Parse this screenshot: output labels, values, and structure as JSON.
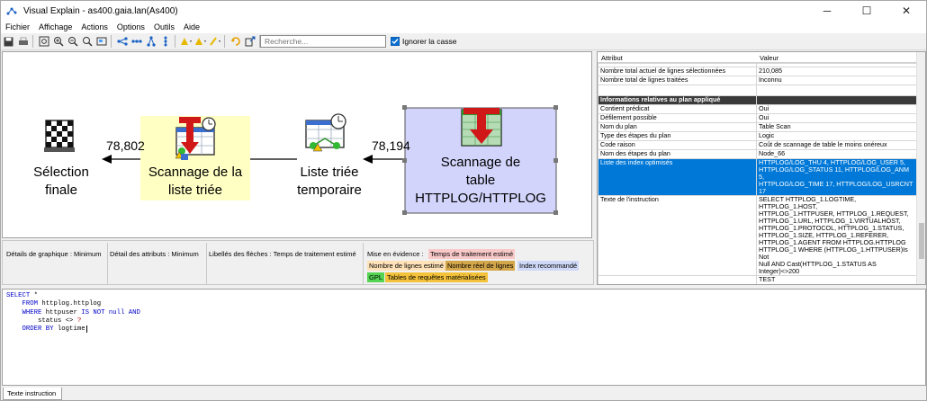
{
  "window": {
    "title": "Visual Explain - as400.gaia.lan(As400)",
    "controls": [
      "─",
      "☐",
      "✕"
    ]
  },
  "menu": [
    "Fichier",
    "Affichage",
    "Actions",
    "Options",
    "Outils",
    "Aide"
  ],
  "toolbar": {
    "search_placeholder": "Recherche...",
    "ignore_case_label": "Ignorer la casse",
    "ignore_case_checked": true
  },
  "diagram": {
    "nodes": [
      {
        "label": "Sélection finale",
        "lines": [
          "Sélection",
          "finale"
        ]
      },
      {
        "label": "Scannage de la liste triée",
        "lines": [
          "Scannage de la",
          "liste triée"
        ]
      },
      {
        "label": "Liste triée temporaire",
        "lines": [
          "Liste triée",
          "temporaire"
        ]
      },
      {
        "label": "Scannage de table HTTPLOG/HTTPLOG",
        "lines": [
          "Scannage de",
          "table",
          "HTTPLOG/HTTPLOG"
        ]
      }
    ],
    "edges": [
      {
        "label": "78,802"
      },
      {
        "label": "78,194"
      }
    ]
  },
  "legend": {
    "graphic_detail": "Détails de graphique :   Minimum",
    "attr_detail": "Détail des attributs :   Minimum",
    "arrow_labels": "Libellés des flèches :    Temps de traitement estimé",
    "highlight_title": "Mise en évidence :",
    "highlights": [
      {
        "label": "Temps de traitement estimé",
        "color": "#f9c9c9"
      },
      {
        "label": "Nombre de lignes estimé",
        "color": "#ffe2b8"
      },
      {
        "label": "Nombre réel de lignes",
        "color": "#d4a64a"
      },
      {
        "label": "Index recommandé",
        "color": "#cfd9f7"
      },
      {
        "label": "GPL",
        "color": "#53d453"
      },
      {
        "label": "Tables de requêtes matérialisées",
        "color": "#f4c23a"
      }
    ]
  },
  "properties": {
    "headers": [
      "Attribut",
      "Valeur"
    ],
    "rows": [
      {
        "attr": "",
        "value": ""
      },
      {
        "attr": "Nombre total actuel de lignes sélectionnées",
        "value": "210,085"
      },
      {
        "attr": "Nombre total de lignes traitées",
        "value": "Inconnu"
      },
      {
        "attr": "",
        "value": ""
      },
      {
        "attr": "Informations relatives au plan appliqué",
        "value": "",
        "section": true
      },
      {
        "attr": "Contient prédicat",
        "value": "Oui"
      },
      {
        "attr": "Défilement possible",
        "value": "Oui"
      },
      {
        "attr": "Nom du plan",
        "value": "Table Scan"
      },
      {
        "attr": "Type des étapes du plan",
        "value": "Logic"
      },
      {
        "attr": "Code raison",
        "value": "Coût de scannage de table le moins onéreux"
      },
      {
        "attr": "Nom des étapes du plan",
        "value": "Node_66"
      },
      {
        "attr": "Liste des index optimisés",
        "value": "HTTPLOG/LOG_THU 4, HTTPLOG/LOG_USER 5, HTTPLOG/LOG_STATUS 11, HTTPLOG/LOG_ANM 5, HTTPLOG/LOG_TIME 17, HTTPLOG/LOG_USRCNT 17",
        "selected": true,
        "lines": [
          "HTTPLOG/LOG_THU 4, HTTPLOG/LOG_USER 5,",
          "HTTPLOG/LOG_STATUS 11, HTTPLOG/LOG_ANM 5,",
          "HTTPLOG/LOG_TIME 17, HTTPLOG/LOG_USRCNT 17"
        ]
      },
      {
        "attr": "Texte de l'instruction",
        "value": "SELECT HTTPLOG_1.LOGTIME, HTTPLOG_1.HOST, HTTPLOG_1.HTTPUSER, HTTPLOG_1.REQUEST, HTTPLOG_1.URL, HTTPLOG_1.VIRTUALHOST, HTTPLOG_1.PROTOCOL, HTTPLOG_1.STATUS, HTTPLOG_1.SIZE, HTTPLOG_1.REFERER, HTTPLOG_1.AGENT FROM HTTPLOG.HTTPLOG HTTPLOG_1 WHERE (HTTPLOG_1.HTTPUSER)Is Not Null AND Cast(HTTPLOG_1.STATUS AS Integer)<>200",
        "lines": [
          "SELECT HTTPLOG_1.LOGTIME, HTTPLOG_1.HOST,",
          "HTTPLOG_1.HTTPUSER, HTTPLOG_1.REQUEST,",
          "HTTPLOG_1.URL, HTTPLOG_1.VIRTUALHOST,",
          "HTTPLOG_1.PROTOCOL, HTTPLOG_1.STATUS,",
          "HTTPLOG_1.SIZE, HTTPLOG_1.REFERER,",
          "HTTPLOG_1.AGENT FROM HTTPLOG.HTTPLOG",
          "HTTPLOG_1 WHERE (HTTPLOG_1.HTTPUSER)Is Not",
          "Null AND Cast(HTTPLOG_1.STATUS AS",
          "Integer)<>200"
        ]
      },
      {
        "attr": "",
        "value": "TEST"
      }
    ]
  },
  "sql": {
    "lines": [
      [
        {
          "t": "SELECT",
          "k": true
        },
        {
          "t": " *"
        }
      ],
      [
        {
          "t": "    "
        },
        {
          "t": "FROM",
          "k": true
        },
        {
          "t": " httplog.httplog"
        }
      ],
      [
        {
          "t": "    "
        },
        {
          "t": "WHERE",
          "k": true
        },
        {
          "t": " httpuser "
        },
        {
          "t": "IS NOT null AND",
          "k": true
        }
      ],
      [
        {
          "t": "        status <> "
        },
        {
          "t": "?",
          "k": true
        }
      ],
      [
        {
          "t": "    "
        },
        {
          "t": "ORDER BY",
          "k": true
        },
        {
          "t": " logtime"
        }
      ]
    ]
  },
  "bottom_tab": "Texte instruction"
}
